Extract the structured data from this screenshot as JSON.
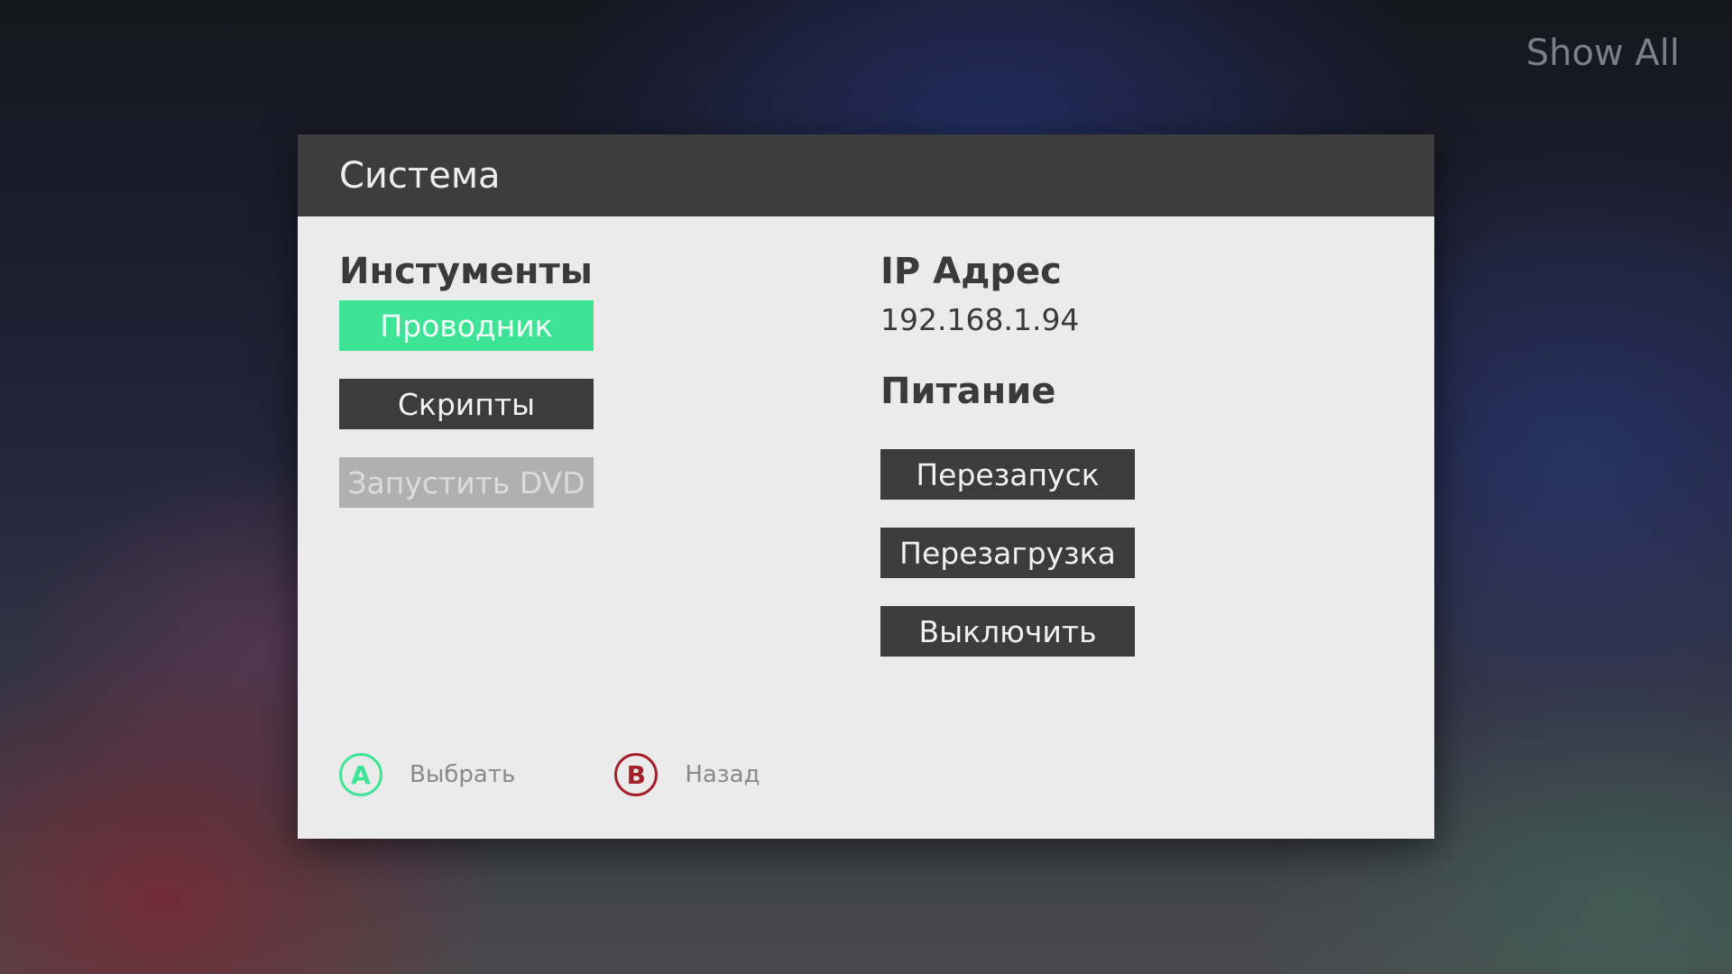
{
  "top_right": {
    "show_all_label": "Show All"
  },
  "dialog": {
    "title": "Система",
    "tools": {
      "heading": "Инстументы",
      "buttons": [
        {
          "label": "Проводник",
          "state": "selected"
        },
        {
          "label": "Скрипты",
          "state": "normal"
        },
        {
          "label": "Запустить DVD",
          "state": "disabled"
        }
      ]
    },
    "network": {
      "heading": "IP Адрес",
      "ip_address": "192.168.1.94"
    },
    "power": {
      "heading": "Питание",
      "buttons": [
        {
          "label": "Перезапуск"
        },
        {
          "label": "Перезагрузка"
        },
        {
          "label": "Выключить"
        }
      ]
    },
    "footer": {
      "a": {
        "glyph": "A",
        "label": "Выбрать"
      },
      "b": {
        "glyph": "B",
        "label": "Назад"
      }
    }
  },
  "colors": {
    "accent_green": "#3ee496",
    "b_button_red": "#a3202b",
    "header_bg": "#3d3d3d",
    "panel_bg": "#ebebeb",
    "button_bg": "#3c3c3c",
    "button_disabled_bg": "#b0b0b0"
  }
}
